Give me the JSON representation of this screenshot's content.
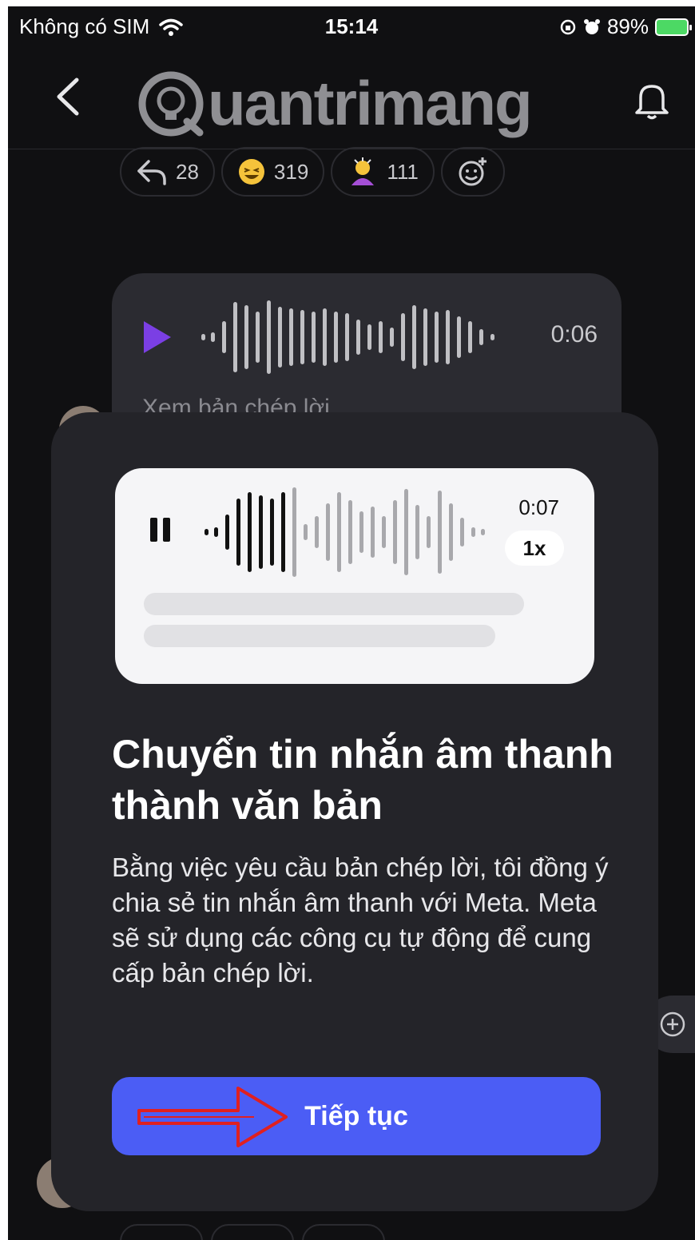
{
  "status_bar": {
    "carrier": "Không có SIM",
    "time": "15:14",
    "battery": "89%"
  },
  "header": {
    "logo_text": "uantrimang",
    "icons": [
      "back-chevron-icon",
      "bell-icon"
    ]
  },
  "reactions": [
    {
      "icon": "reply-icon",
      "count": "28"
    },
    {
      "icon": "laughing-emoji-icon",
      "count": "319"
    },
    {
      "icon": "person-emoji-icon",
      "count": "111"
    },
    {
      "icon": "add-reaction-icon",
      "count": ""
    }
  ],
  "voice_message": {
    "duration": "0:06",
    "transcript_link": "Xem bản chép lời"
  },
  "modal": {
    "preview_duration": "0:07",
    "preview_speed": "1x",
    "title": "Chuyển tin nhắn âm thanh thành văn bản",
    "description": "Bằng việc yêu cầu bản chép lời, tôi đồng ý chia sẻ tin nhắn âm thanh với Meta. Meta sẽ sử dụng các công cụ tự động để cung cấp bản chép lời.",
    "continue_label": "Tiếp tục"
  },
  "colors": {
    "background": "#101012",
    "modal": "#242429",
    "button": "#4b5df5",
    "play": "#7b3fe4",
    "annotation_arrow": "#e02020"
  }
}
